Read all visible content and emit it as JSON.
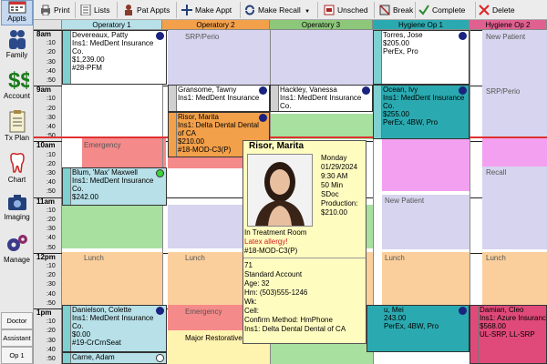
{
  "sidebar": {
    "items": [
      {
        "label": "Appts",
        "icon": "calendar-icon"
      },
      {
        "label": "Family",
        "icon": "family-icon"
      },
      {
        "label": "Account",
        "icon": "dollar-icon"
      },
      {
        "label": "Tx Plan",
        "icon": "clipboard-icon"
      },
      {
        "label": "Chart",
        "icon": "tooth-icon"
      },
      {
        "label": "Imaging",
        "icon": "camera-icon"
      },
      {
        "label": "Manage",
        "icon": "gears-icon"
      }
    ],
    "buttons": [
      "Doctor",
      "Assistant",
      "Op 1"
    ]
  },
  "toolbar": {
    "print": "Print",
    "lists": "Lists",
    "pat_appts": "Pat Appts",
    "make_appt": "Make Appt",
    "make_recall": "Make Recall",
    "unsched": "Unsched",
    "break": "Break",
    "complete": "Complete",
    "delete": "Delete"
  },
  "operatories": [
    "Operatory 1",
    "Operatory 2",
    "Operatory 3",
    "Hygiene Op 1",
    "Hygiene Op 2"
  ],
  "op_colors": [
    "#b7e0e8",
    "#f2a04a",
    "#8cc77a",
    "#2aaab0",
    "#e06090"
  ],
  "times": {
    "8": {
      "hour": "8am",
      "mins": [
        ":10",
        ":20",
        ":30",
        ":40",
        ":50"
      ]
    },
    "9": {
      "hour": "9am",
      "mins": [
        ":10",
        ":20",
        ":30",
        ":40",
        ":50"
      ]
    },
    "10": {
      "hour": "10am",
      "mins": [
        ":10",
        ":20",
        ":30",
        ":40",
        ":50"
      ]
    },
    "11": {
      "hour": "11am",
      "mins": [
        ":10",
        ":20",
        ":30",
        ":40",
        ":50"
      ]
    },
    "12": {
      "hour": "12pm",
      "mins": [
        ":10",
        ":20",
        ":30",
        ":40",
        ":50"
      ]
    },
    "1": {
      "hour": "1pm",
      "mins": [
        ":10",
        ":20",
        ":30",
        ":40",
        ":50"
      ]
    }
  },
  "blocks": {
    "srp_perio": "SRP/Perio",
    "new_patient": "New Patient",
    "emergency": "Emergency",
    "recall": "Recall",
    "lunch": "Lunch",
    "major_restorative": "Major Restorative"
  },
  "appointments": {
    "devereaux": [
      "Devereaux, Patty",
      "Ins1: MedDent Insurance",
      "Co.",
      "$1,239.00",
      "#28-PFM"
    ],
    "torres": [
      "Torres, Jose",
      "$205.00",
      "PerEx, Pro"
    ],
    "gransome": [
      "Gransome, Tawny",
      "Ins1: MedDent Insurance"
    ],
    "hackley": [
      "Hackley, Vanessa",
      "Ins1: MedDent Insurance",
      "Co."
    ],
    "ocean": [
      "Ocean, Ivy",
      "Ins1: MedDent Insurance",
      "Co.",
      "$255.00",
      "PerEx, 4BW, Pro"
    ],
    "risor": [
      "Risor, Marita",
      "Ins1: Delta Dental Dental",
      "of CA",
      "$210.00",
      "#18-MOD-C3(P)"
    ],
    "blum": [
      "Blum, 'Max' Maxwell",
      "Ins1: MedDent Insurance",
      "Co.",
      "$242.00"
    ],
    "danielson": [
      "Danielson, Colette",
      "Ins1: MedDent Insurance",
      "Co.",
      "$0.00",
      "#19-CrCrnSeat"
    ],
    "mei": [
      "u, Mei",
      "243.00",
      "PerEx, 4BW, Pro"
    ],
    "damian": [
      "Damian, Cleo",
      "Ins1: Azure Insurance",
      "$568.00",
      "UL-SRP, LL-SRP"
    ],
    "carne": [
      "Carne, Adam"
    ]
  },
  "popup": {
    "name": "Risor, Marita",
    "day": "Monday",
    "date": "01/29/2024",
    "time": "9:30 AM",
    "length": "50 Min",
    "provider": "SDoc",
    "production_label": "Production:",
    "production": "$210.00",
    "status": "In Treatment Room",
    "allergy": "Latex allergy!",
    "proc": "#18-MOD-C3(P)",
    "patnum": "71",
    "account": "Standard Account",
    "age": "Age: 32",
    "hm": "Hm: (503)555-1246",
    "wk": "Wk:",
    "cell": "Cell:",
    "confirm": "Confirm Method: HmPhone",
    "ins": "Ins1: Delta Dental Dental of CA"
  }
}
